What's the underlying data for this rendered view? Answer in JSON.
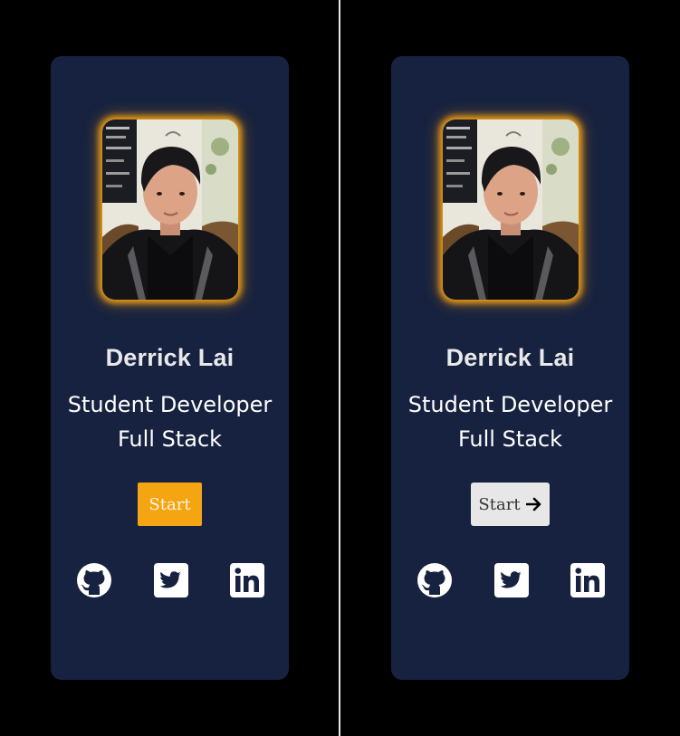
{
  "cards": [
    {
      "state": "default",
      "name": "Derrick Lai",
      "role_line1": "Student Developer",
      "role_line2": "Full Stack",
      "start_label": "Start",
      "start_has_arrow": false
    },
    {
      "state": "hover",
      "name": "Derrick Lai",
      "role_line1": "Student Developer",
      "role_line2": "Full Stack",
      "start_label": "Start",
      "start_has_arrow": true
    }
  ],
  "social_icons": [
    "github-icon",
    "twitter-icon",
    "linkedin-icon"
  ],
  "colors": {
    "page_background": "#000000",
    "card_background": "#16223f",
    "accent": "#f5a511",
    "button_hover_background": "#e7e7e7",
    "text": "#ffffff"
  }
}
